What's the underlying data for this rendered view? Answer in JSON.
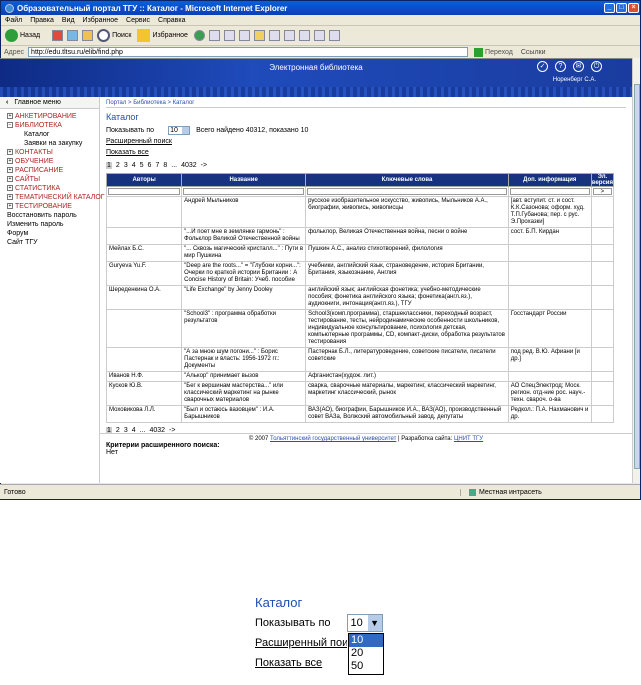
{
  "window": {
    "title": "Образовательный портал ТГУ :: Каталог - Microsoft Internet Explorer"
  },
  "menu": [
    "Файл",
    "Правка",
    "Вид",
    "Избранное",
    "Сервис",
    "Справка"
  ],
  "toolbar": {
    "back": "Назад",
    "search": "Поиск",
    "favorites": "Избранное"
  },
  "address": {
    "label": "Адрес",
    "url": "http://edu.tltsu.ru/elib/find.php",
    "go": "Переход",
    "links": "Ссылки"
  },
  "banner": {
    "title": "Электронная библиотека",
    "user": "Норенберг С.А."
  },
  "sidebar": {
    "header": "Главное меню",
    "items": [
      {
        "label": "АНКЕТИРОВАНИЕ",
        "type": "group",
        "sign": "+"
      },
      {
        "label": "БИБЛИОТЕКА",
        "type": "group",
        "sign": "−"
      },
      {
        "label": "Каталог",
        "type": "sub"
      },
      {
        "label": "Заявки на закупку",
        "type": "sub"
      },
      {
        "label": "КОНТАКТЫ",
        "type": "group",
        "sign": "+"
      },
      {
        "label": "ОБУЧЕНИЕ",
        "type": "group",
        "sign": "+"
      },
      {
        "label": "РАСПИСАНИЕ",
        "type": "group",
        "sign": "+"
      },
      {
        "label": "САЙТЫ",
        "type": "group",
        "sign": "+"
      },
      {
        "label": "СТАТИСТИКА",
        "type": "group",
        "sign": "+"
      },
      {
        "label": "ТЕМАТИЧЕСКИЙ КАТАЛОГ",
        "type": "group",
        "sign": "+"
      },
      {
        "label": "ТЕСТИРОВАНИЕ",
        "type": "group",
        "sign": "+"
      },
      {
        "label": "Восстановить пароль",
        "type": "plain"
      },
      {
        "label": "Изменить пароль",
        "type": "plain"
      },
      {
        "label": "Форум",
        "type": "plain"
      },
      {
        "label": "Сайт ТГУ",
        "type": "plain"
      }
    ]
  },
  "main": {
    "breadcrumbs": "Портал > Библиотека > Каталог",
    "title": "Каталог",
    "show_label": "Показывать по",
    "show_value": "10",
    "found": "Всего найдено 40312, показано 10",
    "adv_search": "Расширенный поиск",
    "show_all": "Показать все",
    "pager_top": [
      "1",
      "2",
      "3",
      "4",
      "5",
      "6",
      "7",
      "8",
      "...",
      "4032",
      "->"
    ],
    "pager_bottom": [
      "1",
      "2",
      "3",
      "4",
      "...",
      "4032",
      "->"
    ],
    "columns": [
      "Авторы",
      "Название",
      "Ключевые слова",
      "Доп. информация",
      "Эл. версия"
    ],
    "filter_btn": ">",
    "rows": [
      {
        "author": "",
        "title": "Андрей Мыльников",
        "keywords": "русское изобразительное искусство, живопись, Мыльников А.А., биографии, живопись, живописцы",
        "info": "[авт. вступит. ст. и сост. К.К.Сазонова; оформ. худ. Т.П.Губанова; пер. с рус. Э.Прохазки]"
      },
      {
        "author": "",
        "title": "\"...И поет мне в землянке гармонь\" : Фольклор Великой Отечественной войны",
        "keywords": "фольклор, Великая Отечественная война, песни о войне",
        "info": "сост. Б.П. Кирдан"
      },
      {
        "author": "Мейлах Б.С.",
        "title": "\"... Сквозь магический кристалл...\" : Пути в мир Пушкина",
        "keywords": "Пушкин А.С., анализ стихотворений, филология",
        "info": ""
      },
      {
        "author": "Guryeva Yu.F.",
        "title": "\"Deep are the roots...\" = \"Глубоки корни...\": Очерки по краткой истории Британии : A Concise History of Britain: Учеб. пособие",
        "keywords": "учебники, английский язык, страноведение, история Британии, Британия, языкознание, Англия",
        "info": ""
      },
      {
        "author": "Шереденкина О.А.",
        "title": "\"Life Exchange\" by Jenny Dooley",
        "keywords": "английский язык; английская фонетика; учебно-методические пособия; фонетика английского языка; фонетика(англ.яз.), аудиокниги, интонация(англ.яз.), ТГУ",
        "info": ""
      },
      {
        "author": "",
        "title": "\"School3\" : программа обработки результатов",
        "keywords": "School3(комп.программа), старшеклассники, переходный возраст, тестирование, тесты, нейродинамические особенности школьников, индивидуальное консультирование, психология детская, компьютерные программы, CD, компакт-диски, обработка результатов тестирования",
        "info": "Госстандарт России"
      },
      {
        "author": "",
        "title": "\"А за мною шум погони...\" : Борис Пастернак и власть: 1956-1972 гг.: Документы",
        "keywords": "Пастернак Б.Л., литературоведение, советские писатели, писатели советские",
        "info": "под ред. В.Ю. Афиани [и др.]"
      },
      {
        "author": "Иванов Н.Ф.",
        "title": "\"Алькор\" принимает вызов",
        "keywords": "Афганистан(худож. лит.)",
        "info": ""
      },
      {
        "author": "Кусков Ю.В.",
        "title": "\"Бег к вершинам мастерства...\" или классический маркетинг на рынке сварочных материалов",
        "keywords": "сварка, сварочные материалы, маркетинг, классический маркетинг, маркетинг классический, рынок",
        "info": "АО СпецЭлектрод; Моск. регион. отд-ние рос. науч.-техн. сварoч. о-ва"
      },
      {
        "author": "Моховикова Л.Л.",
        "title": "\"Был и остаюсь вазовцем\" : И.А. Барышников",
        "keywords": "ВАЗ(АО), биографии, Барышников И.А., ВАЗ(АО), производственный совет ВАЗа, Волжский автомобильный завод, депутаты",
        "info": "Редкол.: П.А. Нахманович и др."
      }
    ],
    "criteria_label": "Критерии расширенного поиска:",
    "criteria_value": "Нет"
  },
  "footer": {
    "pre": "© 2007 ",
    "univ": "Тольяттинский государственный университет",
    "mid": " | Разработка сайта: ",
    "dev": "ЦНИТ ТГУ"
  },
  "status": {
    "done": "Готово",
    "zone": "Местная интрасеть"
  },
  "zoom": {
    "title": "Каталог",
    "show_label": "Показывать по",
    "value": "10",
    "options": [
      "10",
      "20",
      "50"
    ],
    "adv_search": "Расширенный поиск",
    "show_all": "Показать все"
  }
}
